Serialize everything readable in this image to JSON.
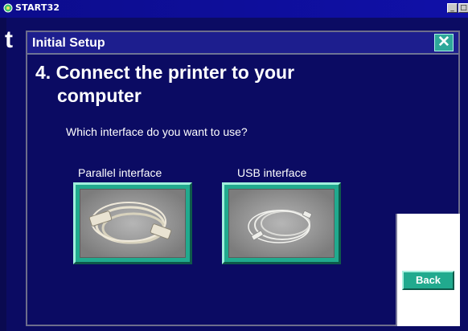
{
  "window": {
    "title": "START32",
    "app_icon": "start32-app-icon",
    "minimize_icon": "minimize-icon",
    "maximize_icon": "maximize-icon",
    "close_icon": "close-icon"
  },
  "background": {
    "partial_glyph": "t"
  },
  "dialog": {
    "title": "Initial Setup",
    "close_glyph": "✕",
    "step_heading_line1": "4. Connect the printer to your",
    "step_heading_line2": "computer",
    "question": "Which interface do you want to use?",
    "options": [
      {
        "label": "Parallel interface",
        "image": "parallel-cable-photo"
      },
      {
        "label": "USB interface",
        "image": "usb-cable-photo"
      }
    ],
    "back_label": "Back"
  },
  "colors": {
    "background": "#0b0b63",
    "dialog_titlebar": "#1d1e8e",
    "accent_teal": "#21aa8e",
    "text": "#ffffff"
  }
}
